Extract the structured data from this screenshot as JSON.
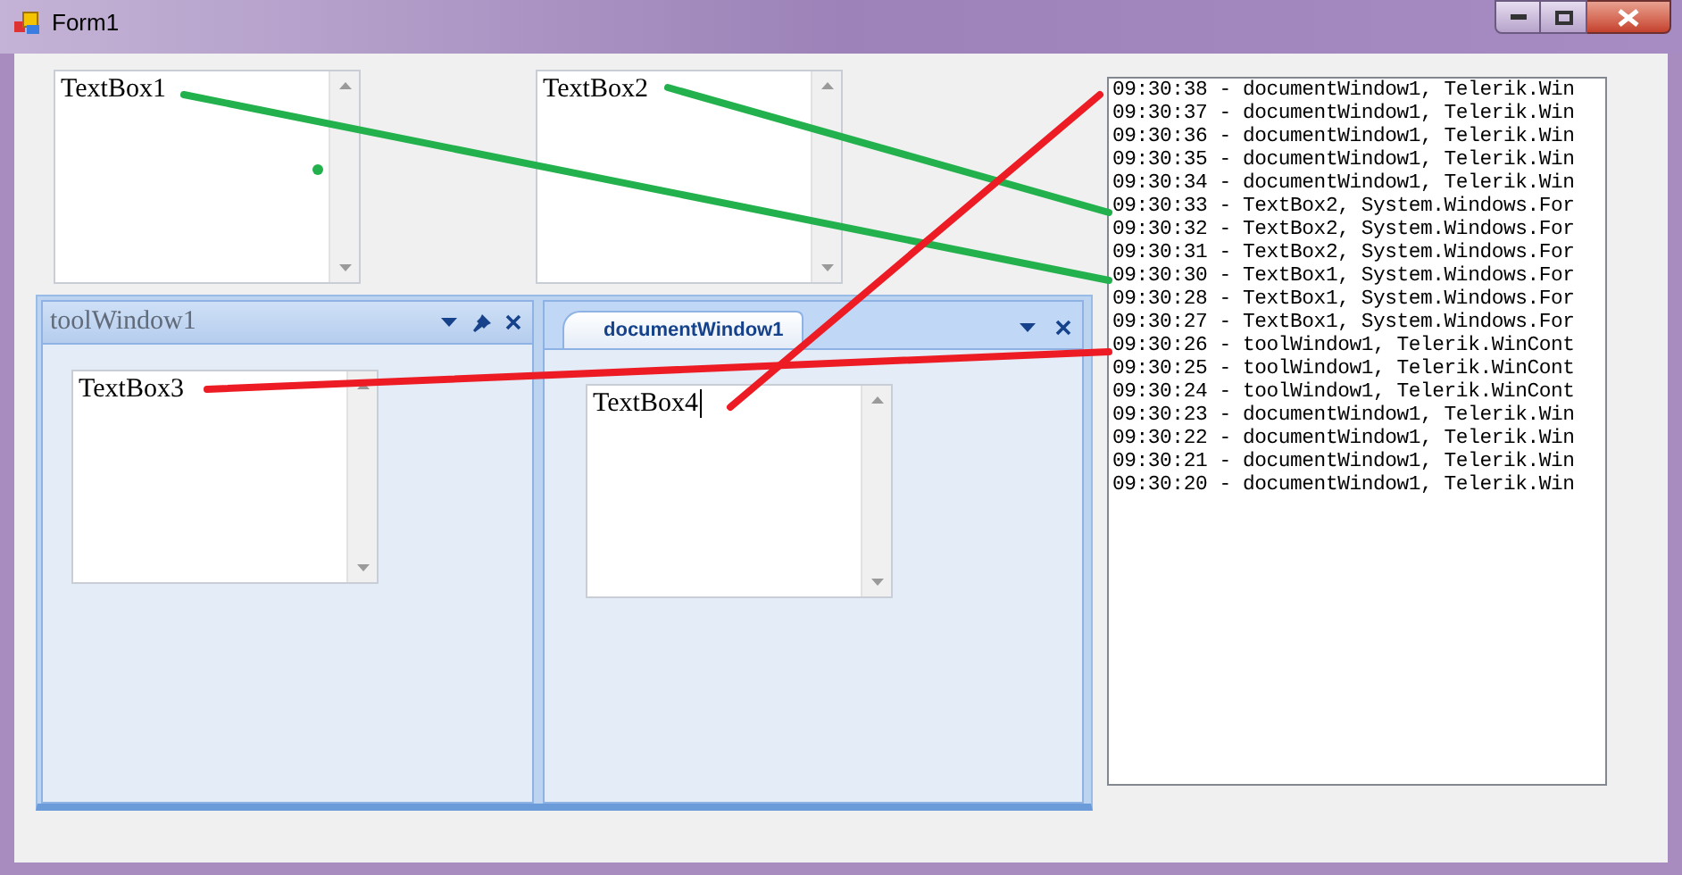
{
  "window": {
    "title": "Form1"
  },
  "top_textboxes": [
    {
      "text": "TextBox1"
    },
    {
      "text": "TextBox2"
    }
  ],
  "dock": {
    "tool_window": {
      "title": "toolWindow1",
      "textbox": {
        "text": "TextBox3",
        "focused": false
      }
    },
    "document_window": {
      "tab": "documentWindow1",
      "textbox": {
        "text": "TextBox4",
        "focused": true
      }
    }
  },
  "log": [
    "09:30:38 - documentWindow1, Telerik.Win",
    "09:30:37 - documentWindow1, Telerik.Win",
    "09:30:36 - documentWindow1, Telerik.Win",
    "09:30:35 - documentWindow1, Telerik.Win",
    "09:30:34 - documentWindow1, Telerik.Win",
    "09:30:33 - TextBox2, System.Windows.For",
    "09:30:32 - TextBox2, System.Windows.For",
    "09:30:31 - TextBox2, System.Windows.For",
    "09:30:30 - TextBox1, System.Windows.For",
    "09:30:28 - TextBox1, System.Windows.For",
    "09:30:27 - TextBox1, System.Windows.For",
    "09:30:26 - toolWindow1, Telerik.WinCont",
    "09:30:25 - toolWindow1, Telerik.WinCont",
    "09:30:24 - toolWindow1, Telerik.WinCont",
    "09:30:23 - documentWindow1, Telerik.Win",
    "09:30:22 - documentWindow1, Telerik.Win",
    "09:30:21 - documentWindow1, Telerik.Win",
    "09:30:20 - documentWindow1, Telerik.Win"
  ],
  "annotations": [
    {
      "kind": "line",
      "color": "#22b14c"
    },
    {
      "kind": "line",
      "color": "#22b14c"
    },
    {
      "kind": "dot",
      "color": "#22b14c"
    },
    {
      "kind": "line",
      "color": "#ed1c24"
    },
    {
      "kind": "line",
      "color": "#ed1c24"
    }
  ]
}
